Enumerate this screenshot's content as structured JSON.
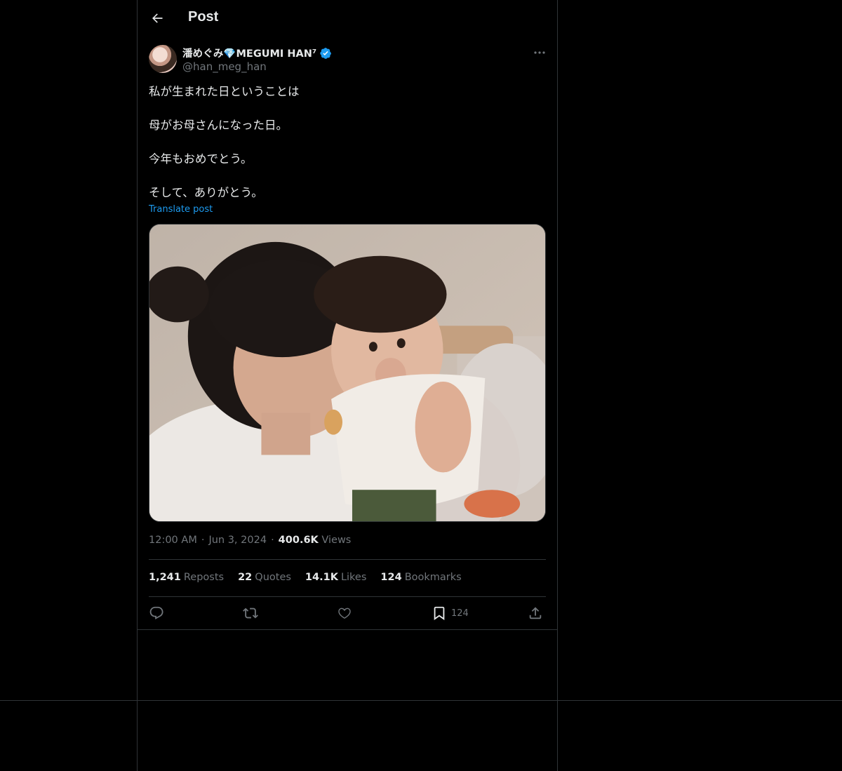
{
  "header": {
    "title": "Post",
    "back_icon": "arrow-left-icon"
  },
  "author": {
    "display_name": "潘めぐみ💎MEGUMI HAN⁷",
    "handle": "@han_meg_han",
    "verified_color": "#1d9bf0"
  },
  "tweet": {
    "lines": [
      "私が生まれた日ということは",
      "母がお母さんになった日。",
      "今年もおめでとう。",
      "そして、ありがとう。"
    ],
    "translate_label": "Translate post"
  },
  "meta": {
    "time": "12:00 AM",
    "date": "Jun 3, 2024",
    "views_count": "400.6K",
    "views_label": "Views",
    "separator": "·"
  },
  "stats": {
    "reposts": {
      "count": "1,241",
      "label": "Reposts"
    },
    "quotes": {
      "count": "22",
      "label": "Quotes"
    },
    "likes": {
      "count": "14.1K",
      "label": "Likes"
    },
    "bookmarks": {
      "count": "124",
      "label": "Bookmarks"
    }
  },
  "actions": {
    "reply_icon": "reply-icon",
    "repost_icon": "repost-icon",
    "like_icon": "heart-icon",
    "bookmark_icon": "bookmark-icon",
    "bookmark_count": "124",
    "share_icon": "share-icon"
  },
  "colors": {
    "background": "#000000",
    "text": "#e7e9ea",
    "muted": "#71767b",
    "accent": "#1d9bf0",
    "border": "#2f3336"
  }
}
